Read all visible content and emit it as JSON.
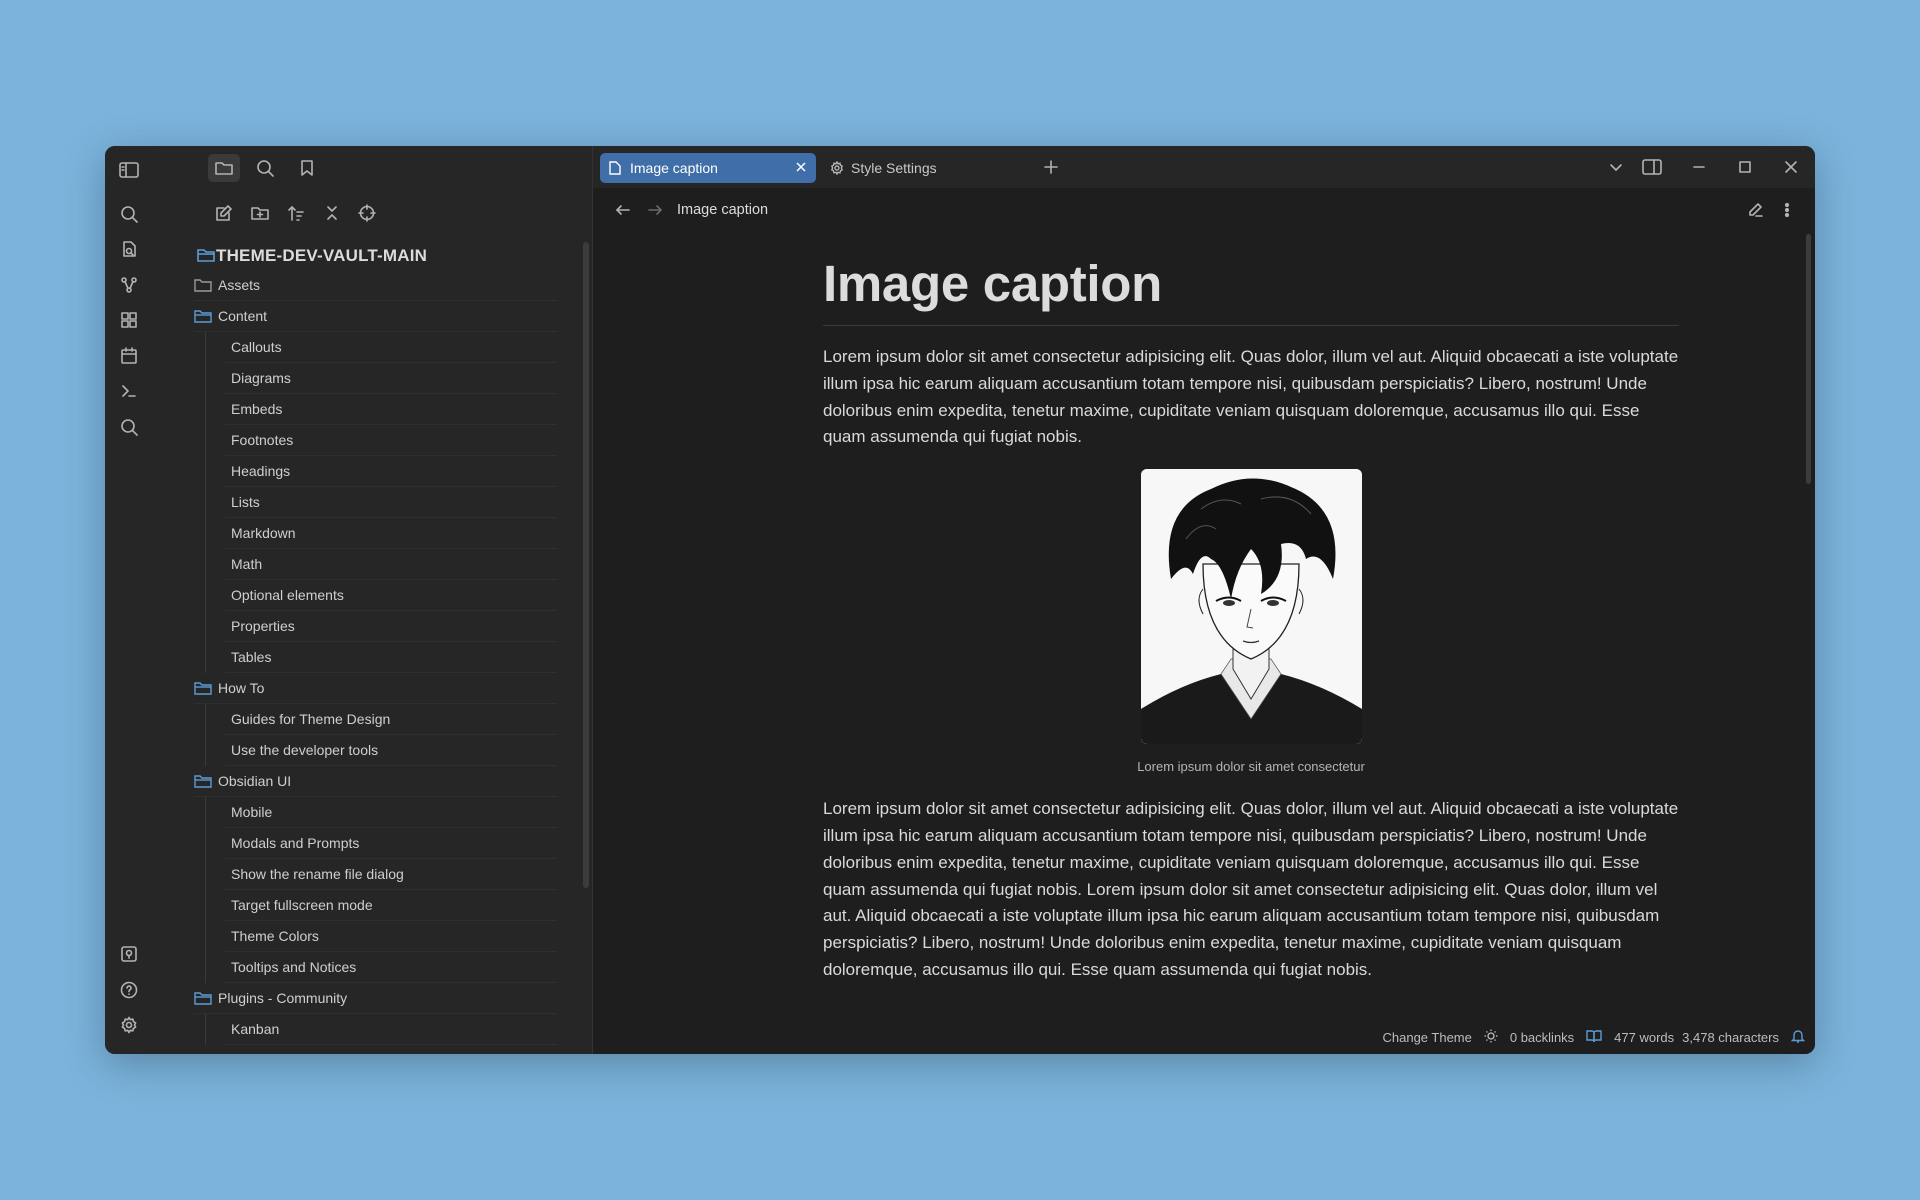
{
  "sidebar": {
    "vault_name": "THEME-DEV-VAULT-MAIN",
    "tree": [
      {
        "type": "folder",
        "label": "Assets",
        "open": false
      },
      {
        "type": "folder",
        "label": "Content",
        "open": true
      },
      {
        "type": "file",
        "label": "Callouts"
      },
      {
        "type": "file",
        "label": "Diagrams"
      },
      {
        "type": "file",
        "label": "Embeds"
      },
      {
        "type": "file",
        "label": "Footnotes"
      },
      {
        "type": "file",
        "label": "Headings"
      },
      {
        "type": "file",
        "label": "Lists"
      },
      {
        "type": "file",
        "label": "Markdown"
      },
      {
        "type": "file",
        "label": "Math"
      },
      {
        "type": "file",
        "label": "Optional elements"
      },
      {
        "type": "file",
        "label": "Properties"
      },
      {
        "type": "file",
        "label": "Tables"
      },
      {
        "type": "folder",
        "label": "How To",
        "open": true
      },
      {
        "type": "file",
        "label": "Guides for Theme Design"
      },
      {
        "type": "file",
        "label": "Use the developer tools"
      },
      {
        "type": "folder",
        "label": "Obsidian UI",
        "open": true
      },
      {
        "type": "file",
        "label": "Mobile"
      },
      {
        "type": "file",
        "label": "Modals and Prompts"
      },
      {
        "type": "file",
        "label": "Show the rename file dialog"
      },
      {
        "type": "file",
        "label": "Target fullscreen mode"
      },
      {
        "type": "file",
        "label": "Theme Colors"
      },
      {
        "type": "file",
        "label": "Tooltips and Notices"
      },
      {
        "type": "folder",
        "label": "Plugins - Community",
        "open": true
      },
      {
        "type": "file",
        "label": "Kanban"
      }
    ]
  },
  "tabs": {
    "active": "Image caption",
    "second": "Style Settings"
  },
  "nav": {
    "breadcrumb": "Image caption"
  },
  "note": {
    "title": "Image caption",
    "para1": "Lorem ipsum dolor sit amet consectetur adipisicing elit. Quas dolor, illum vel aut. Aliquid obcaecati a iste voluptate illum ipsa hic earum aliquam accusantium totam tempore nisi, quibusdam perspiciatis? Libero, nostrum! Unde doloribus enim expedita, tenetur maxime, cupiditate veniam quisquam doloremque, accusamus illo qui. Esse quam assumenda qui fugiat nobis.",
    "caption": "Lorem ipsum dolor sit amet consectetur",
    "para2": "Lorem ipsum dolor sit amet consectetur adipisicing elit. Quas dolor, illum vel aut. Aliquid obcaecati a iste voluptate illum ipsa hic earum aliquam accusantium totam tempore nisi, quibusdam perspiciatis? Libero, nostrum! Unde doloribus enim expedita, tenetur maxime, cupiditate veniam quisquam doloremque, accusamus illo qui. Esse quam assumenda qui fugiat nobis. Lorem ipsum dolor sit amet consectetur adipisicing elit. Quas dolor, illum vel aut. Aliquid obcaecati a iste voluptate illum ipsa hic earum aliquam accusantium totam tempore nisi, quibusdam perspiciatis? Libero, nostrum! Unde doloribus enim expedita, tenetur maxime, cupiditate veniam quisquam doloremque, accusamus illo qui. Esse quam assumenda qui fugiat nobis."
  },
  "status": {
    "change_theme": "Change Theme",
    "backlinks": "0 backlinks",
    "words": "477 words",
    "characters": "3,478 characters"
  },
  "colors": {
    "accent": "#3f6ea8",
    "folder_icon": "#5b9bd5",
    "background": "#7ab3dc"
  }
}
